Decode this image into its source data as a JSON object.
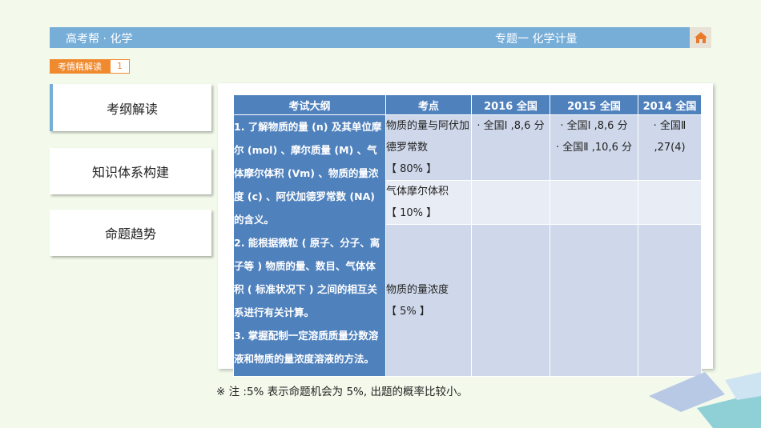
{
  "header": {
    "brand": "高考帮 · 化学",
    "subject": "专题一  化学计量",
    "home_icon": "home-icon"
  },
  "section_tag": {
    "label": "考情精解读",
    "number": "1"
  },
  "sidebar": {
    "items": [
      {
        "label": "考纲解读",
        "active": true
      },
      {
        "label": "知识体系构建",
        "active": false
      },
      {
        "label": "命题趋势",
        "active": false
      }
    ]
  },
  "table": {
    "headers": [
      "考试大纲",
      "考点",
      "2016 全国",
      "2015 全国",
      "2014 全国"
    ],
    "outline": [
      "1. 了解物质的量 (n) 及其单位摩尔 (mol) 、摩尔质量 (M) 、气体摩尔体积 (Vm) 、物质的量浓度 (c) 、阿伏加德罗常数 (NA) 的含义。",
      "2. 能根据微粒 ( 原子、分子、离子等 ) 物质的量、数目、气体体积 ( 标准状况下 ) 之间的相互关系进行有关计算。",
      "3. 掌握配制一定溶质质量分数溶液和物质的量浓度溶液的方法。"
    ],
    "rows": [
      {
        "point": "物质的量与阿伏加德罗常数",
        "weight": "【 80% 】",
        "y2016": "· 全国Ⅰ ,8,6 分",
        "y2015_a": "· 全国Ⅰ ,8,6 分",
        "y2015_b": "· 全国Ⅱ ,10,6 分",
        "y2014": "· 全国Ⅱ ,27(4)"
      },
      {
        "point": "气体摩尔体积",
        "weight": "【 10% 】",
        "y2016": "",
        "y2015_a": "",
        "y2015_b": "",
        "y2014": ""
      },
      {
        "point": "物质的量浓度",
        "weight": "【 5% 】",
        "y2016": "",
        "y2015_a": "",
        "y2015_b": "",
        "y2014": ""
      }
    ]
  },
  "footnote": "※ 注 :5% 表示命题机会为 5%, 出题的概率比较小。",
  "colors": {
    "header_bar": "#77aed8",
    "tag_orange": "#f08a2e",
    "table_blue": "#4f81bd",
    "row_dark": "#cfd8ea",
    "row_light": "#e8ecf5"
  }
}
